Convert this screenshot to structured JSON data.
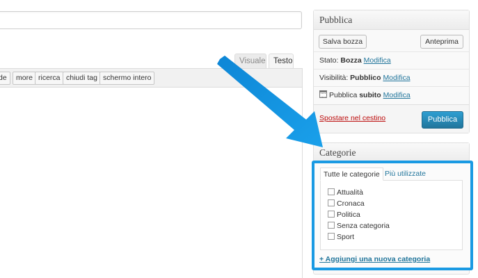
{
  "editor": {
    "tabs": [
      "Visuale",
      "Testo"
    ],
    "quicktags": [
      "de",
      "more",
      "ricerca",
      "chiudi tag",
      "schermo intero"
    ]
  },
  "publish": {
    "title": "Pubblica",
    "save_draft": "Salva bozza",
    "preview": "Anteprima",
    "status_label": "Stato: ",
    "status_value": "Bozza",
    "visibility_label": "Visibilità: ",
    "visibility_value": "Pubblico",
    "publish_label": "Pubblica ",
    "publish_value": "subito",
    "edit_link": "Modifica",
    "trash": "Spostare nel cestino",
    "publish_button": "Pubblica"
  },
  "categories": {
    "title": "Categorie",
    "tab_all": "Tutte le categorie",
    "tab_used": "Più utilizzate",
    "items": [
      "Attualità",
      "Cronaca",
      "Politica",
      "Senza categoria",
      "Sport"
    ],
    "add_new": "+ Aggiungi una nuova categoria"
  },
  "colors": {
    "highlight": "#1a9ae3",
    "link": "#21759b",
    "trash": "#bc0b0b",
    "primary_button": "#21759b"
  },
  "icons": [
    "calendar-icon",
    "arrow-annotation"
  ]
}
